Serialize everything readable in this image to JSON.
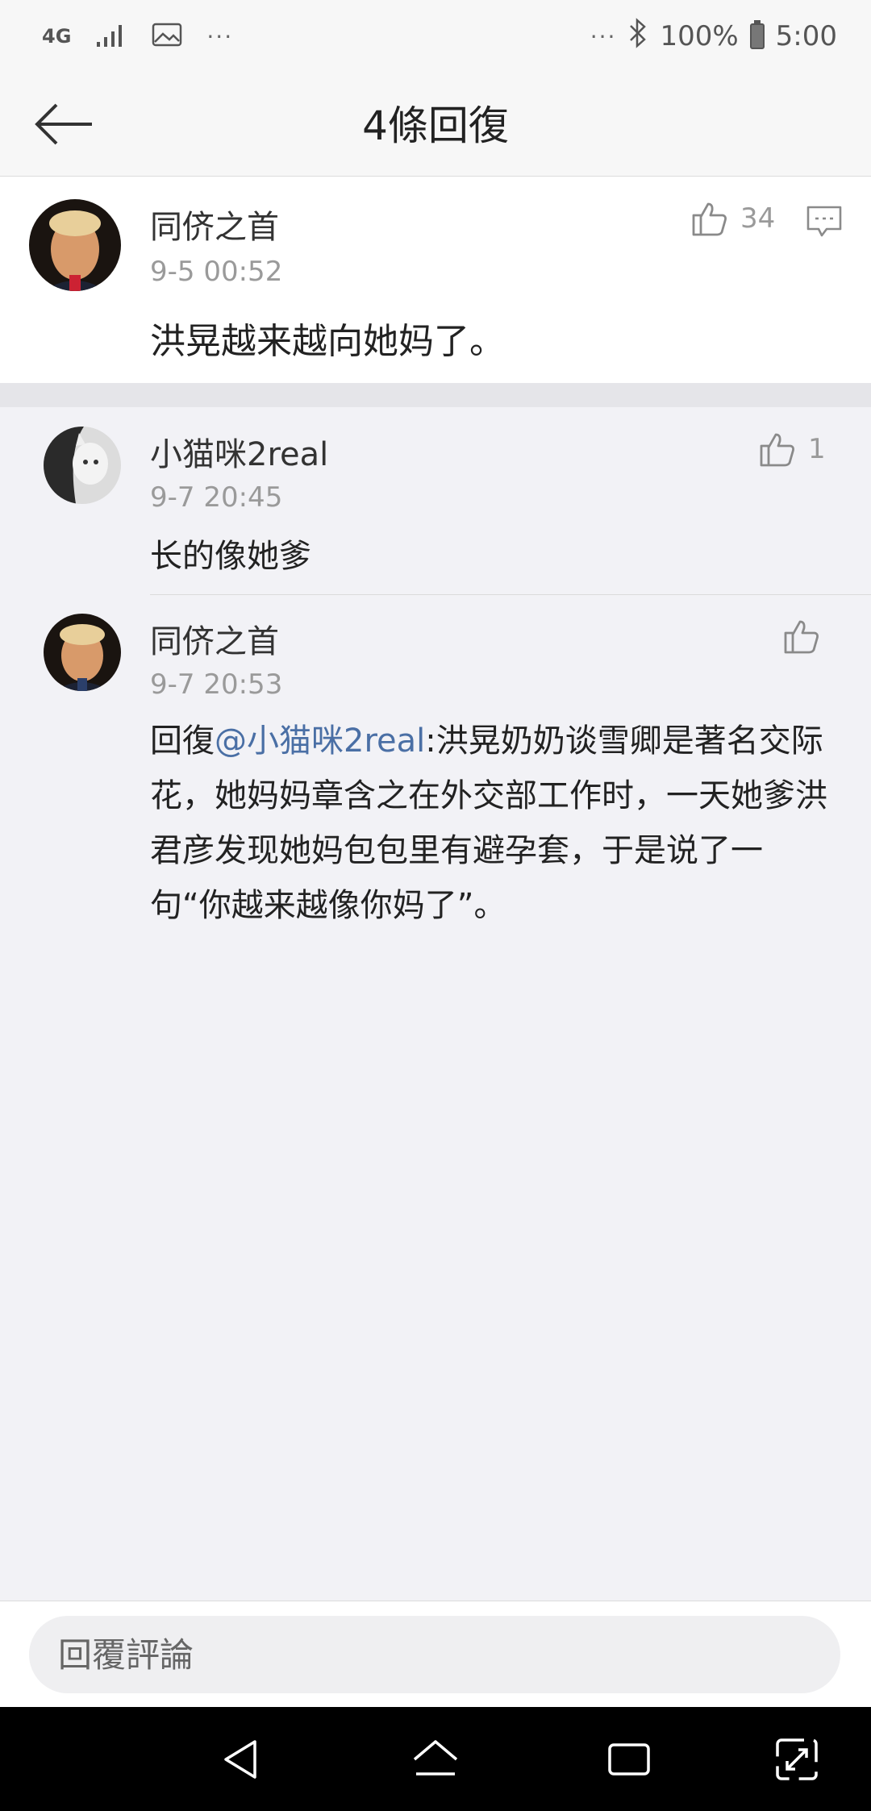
{
  "status_bar": {
    "network_label": "4G",
    "more_left": "···",
    "more_right": "···",
    "battery_percent": "100%",
    "time": "5:00"
  },
  "header": {
    "title": "4條回復"
  },
  "main_comment": {
    "username": "同侪之首",
    "timestamp": "9-5 00:52",
    "text": "洪晃越来越向她妈了。",
    "like_count": "34"
  },
  "replies": [
    {
      "username": "小猫咪2real",
      "timestamp": "9-7 20:45",
      "text": "长的像她爹",
      "like_count": "1"
    },
    {
      "username": "同侪之首",
      "timestamp": "9-7 20:53",
      "reply_prefix": "回復",
      "mention": "@小猫咪2real",
      "text": ":洪晃奶奶谈雪卿是著名交际花，她妈妈章含之在外交部工作时，一天她爹洪君彦发现她妈包包里有避孕套，于是说了一句“你越来越像你妈了”。",
      "like_count": ""
    }
  ],
  "input": {
    "placeholder": "回覆評論"
  },
  "icons": {
    "back": "arrow-left-icon",
    "like": "thumbs-up-icon",
    "comment": "comment-bubble-icon",
    "bluetooth": "bluetooth-icon",
    "signal": "signal-icon",
    "image": "image-icon",
    "battery": "battery-icon"
  },
  "colors": {
    "mention": "#4a6fa5",
    "background": "#f2f2f6",
    "nav_bar": "#000000"
  }
}
